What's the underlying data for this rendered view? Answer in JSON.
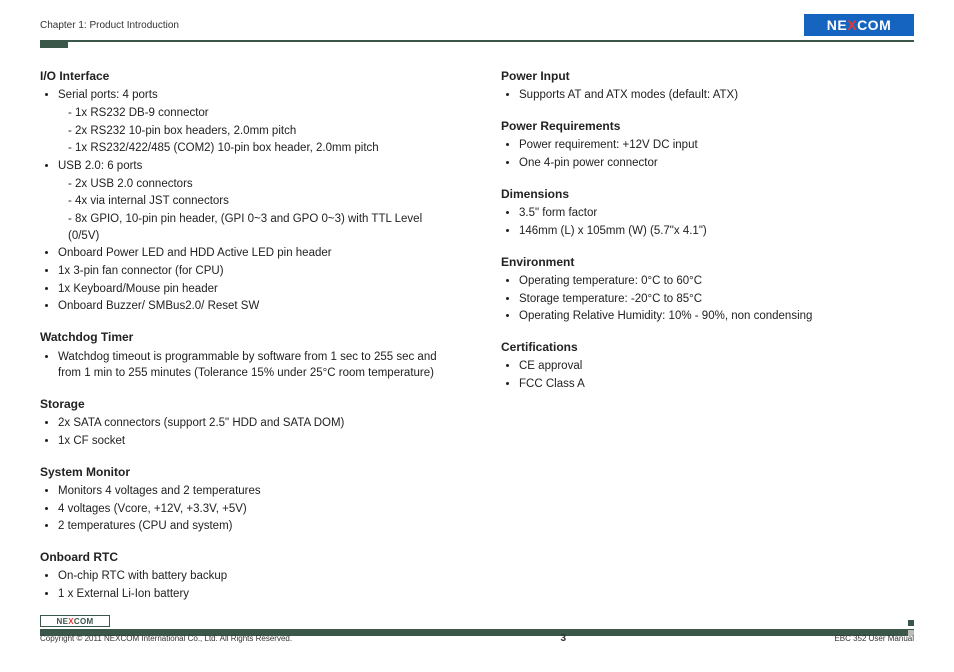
{
  "brand": "NEXCOM",
  "header": {
    "chapter": "Chapter 1: Product Introduction"
  },
  "footer": {
    "copyright": "Copyright © 2011 NEXCOM International Co., Ltd. All Rights Reserved.",
    "page_number": "3",
    "manual": "EBC 352 User Manual"
  },
  "left": {
    "io_interface": {
      "title": "I/O Interface",
      "serial_label": "Serial ports: 4 ports",
      "serial_sub": [
        "1x RS232 DB-9 connector",
        "2x RS232 10-pin box headers, 2.0mm pitch",
        "1x RS232/422/485 (COM2) 10-pin box header, 2.0mm pitch"
      ],
      "usb_label": "USB 2.0: 6 ports",
      "usb_sub": [
        "2x USB 2.0 connectors",
        "4x via internal JST connectors",
        "8x GPIO, 10-pin pin header, (GPI 0~3 and GPO 0~3) with TTL Level (0/5V)"
      ],
      "extra": [
        "Onboard Power LED and HDD Active LED pin header",
        "1x 3-pin fan connector (for CPU)",
        "1x Keyboard/Mouse pin header",
        "Onboard Buzzer/ SMBus2.0/ Reset SW"
      ]
    },
    "watchdog": {
      "title": "Watchdog Timer",
      "items": [
        "Watchdog timeout is programmable by software from 1 sec to 255 sec and from 1 min to 255 minutes (Tolerance 15% under 25°C room temperature)"
      ]
    },
    "storage": {
      "title": "Storage",
      "items": [
        "2x SATA connectors (support 2.5\" HDD and SATA DOM)",
        "1x CF socket"
      ]
    },
    "sysmon": {
      "title": "System Monitor",
      "items": [
        "Monitors 4 voltages and 2 temperatures",
        "4 voltages (Vcore, +12V, +3.3V, +5V)",
        "2 temperatures (CPU and system)"
      ]
    },
    "rtc": {
      "title": "Onboard RTC",
      "items": [
        "On-chip RTC with battery backup",
        "1 x External Li-Ion battery"
      ]
    }
  },
  "right": {
    "power_input": {
      "title": "Power Input",
      "items": [
        "Supports AT and ATX modes (default: ATX)"
      ]
    },
    "power_req": {
      "title": "Power Requirements",
      "items": [
        "Power requirement: +12V DC input",
        "One 4-pin power connector"
      ]
    },
    "dimensions": {
      "title": "Dimensions",
      "items": [
        "3.5\" form factor",
        "146mm (L) x 105mm (W) (5.7\"x 4.1\")"
      ]
    },
    "environment": {
      "title": "Environment",
      "items": [
        "Operating temperature: 0°C to 60°C",
        "Storage temperature: -20°C to 85°C",
        "Operating Relative Humidity: 10% - 90%, non condensing"
      ]
    },
    "cert": {
      "title": "Certifications",
      "items": [
        "CE approval",
        "FCC Class A"
      ]
    }
  }
}
